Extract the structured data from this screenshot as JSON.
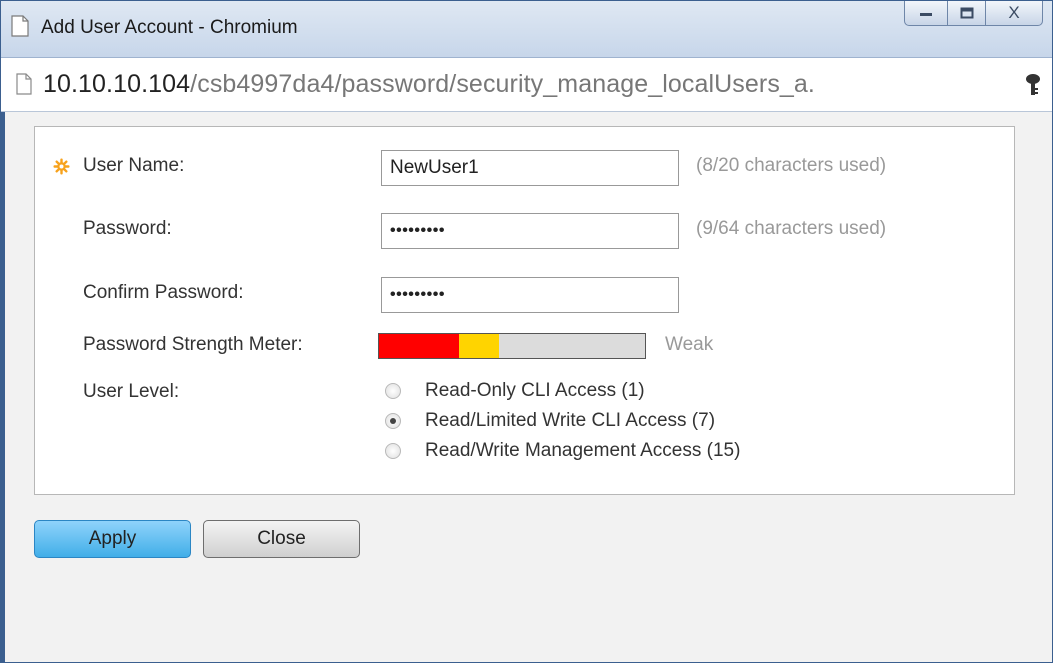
{
  "window": {
    "title": "Add User Account - Chromium",
    "controls": {
      "minimize": "minimize",
      "maximize": "maximize",
      "close": "X"
    }
  },
  "address_bar": {
    "host": "10.10.10.104",
    "path": "/csb4997da4/password/security_manage_localUsers_a."
  },
  "form": {
    "username": {
      "label": "User Name:",
      "value": "NewUser1",
      "hint": "(8/20 characters used)",
      "required": true
    },
    "password": {
      "label": "Password:",
      "value": "•••••••••",
      "hint": "(9/64 characters used)"
    },
    "confirm_password": {
      "label": "Confirm Password:",
      "value": "•••••••••"
    },
    "strength": {
      "label": "Password Strength Meter:",
      "text": "Weak",
      "red_fraction": 0.3,
      "yellow_fraction": 0.15,
      "colors": {
        "red": "#ff0000",
        "yellow": "#ffd400",
        "empty": "#dcdcdc"
      }
    },
    "user_level": {
      "label": "User Level:",
      "options": [
        {
          "label": "Read-Only CLI Access (1)",
          "selected": false
        },
        {
          "label": "Read/Limited Write CLI Access (7)",
          "selected": true
        },
        {
          "label": "Read/Write Management Access (15)",
          "selected": false
        }
      ]
    }
  },
  "buttons": {
    "apply": "Apply",
    "close": "Close"
  },
  "colors": {
    "apply_button": "#41aee8",
    "required_star": "#f7a21c",
    "window_border": "#3b5f8f"
  }
}
